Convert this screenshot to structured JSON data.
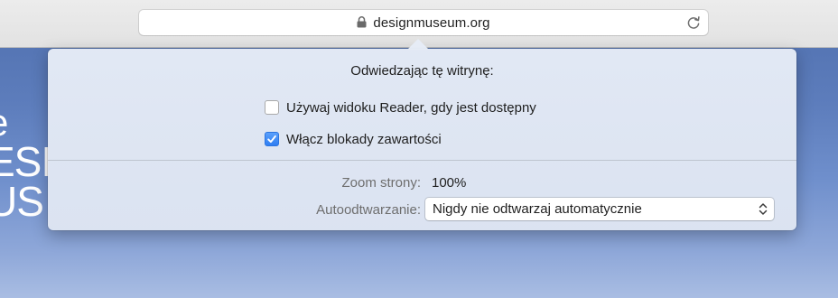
{
  "toolbar": {
    "url": "designmuseum.org",
    "icons": {
      "lock": "lock-icon",
      "reload": "reload-icon"
    }
  },
  "background_page": {
    "line1": "e",
    "line2": "ESI",
    "line3": "US"
  },
  "popover": {
    "title": "Odwiedzając tę witrynę:",
    "options": [
      {
        "label": "Używaj widoku Reader, gdy jest dostępny",
        "checked": false
      },
      {
        "label": "Włącz blokady zawartości",
        "checked": true
      }
    ],
    "zoom": {
      "label": "Zoom strony:",
      "value": "100%"
    },
    "autoplay": {
      "label": "Autoodtwarzanie:",
      "selected": "Nigdy nie odtwarzaj automatycznie"
    }
  },
  "colors": {
    "accent": "#2f7ef2",
    "popover_bg": "#e2e8f4",
    "page_bg": "#5d7dbc"
  }
}
